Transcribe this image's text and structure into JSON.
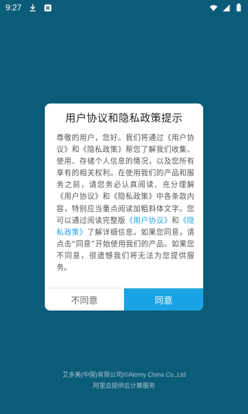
{
  "status_bar": {
    "time": "9:27",
    "icons": [
      "download-icon",
      "app-notification-icon",
      "wifi-icon",
      "cellular-signal-icon",
      "battery-icon"
    ],
    "icon_color": "#ffffff"
  },
  "dialog": {
    "title": "用户协议和隐私政策提示",
    "body_segments": [
      {
        "text": "尊敬的用户，您好。我们将通过《用户协议》和《隐私政策》帮您了解我们收集、使用、存储个人信息的情况，以及您所有享有的相关权利。在使用我们的产品和服务之前，请您务必认真阅读、充分理解《用户协议》和《隐私政策》中各条款内容，特别应当重点阅读加粗斜体文字。您可以通过阅读完整版",
        "link": false
      },
      {
        "text": "《用户协议》",
        "link": true
      },
      {
        "text": "和",
        "link": false
      },
      {
        "text": "《隐私政策》",
        "link": true
      },
      {
        "text": "了解详细信息。如果您同意，请点击“同意”开始使用我们的产品。如果您不同意，很遗憾我们将无法为您提供服务。",
        "link": false
      }
    ],
    "disagree_label": "不同意",
    "agree_label": "同意",
    "colors": {
      "link": "#20a0e8",
      "agree_bg": "#1aa3e4",
      "background": "#0b5c78"
    }
  },
  "footer": {
    "line1": "艾多美(中国)有限公司|©Atomy China Co.,Ltd",
    "line2": "阿里云提供云计算服务"
  }
}
